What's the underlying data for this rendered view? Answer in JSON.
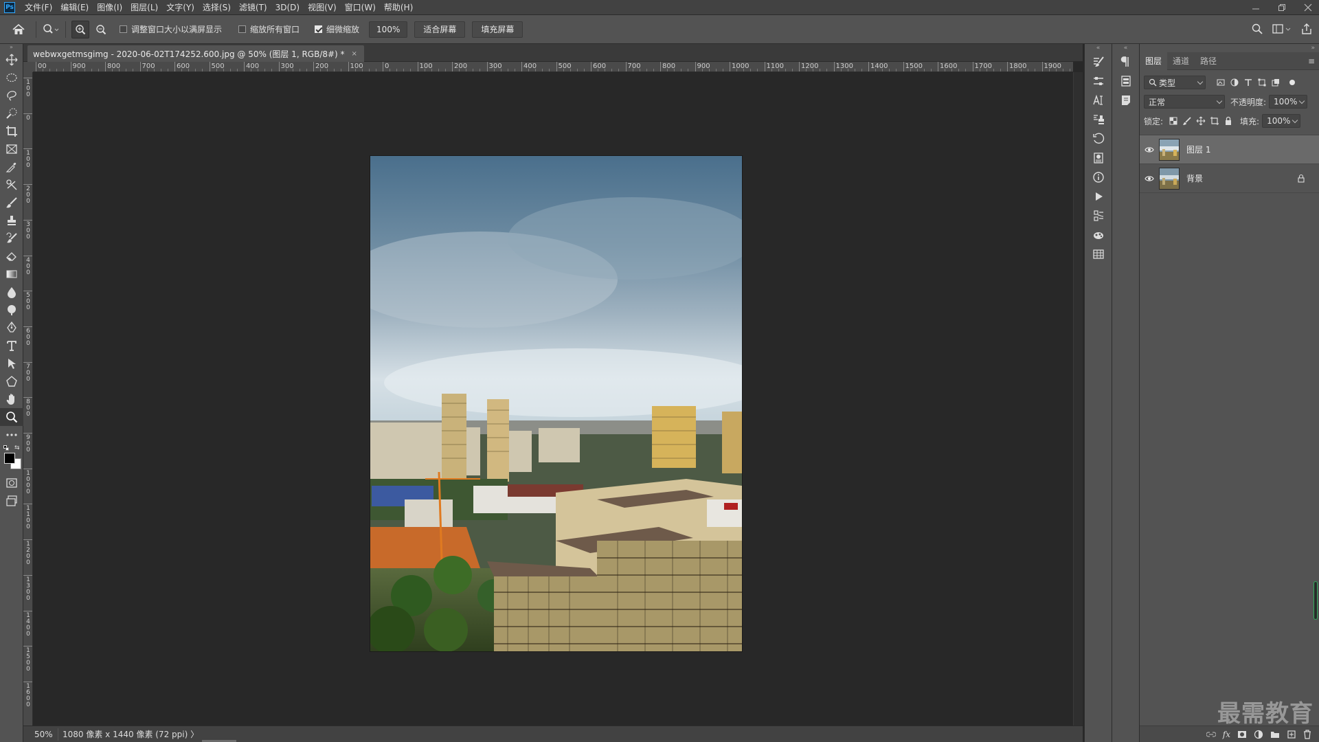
{
  "app": {
    "logo": "Ps"
  },
  "menu": [
    "文件(F)",
    "编辑(E)",
    "图像(I)",
    "图层(L)",
    "文字(Y)",
    "选择(S)",
    "滤镜(T)",
    "3D(D)",
    "视图(V)",
    "窗口(W)",
    "帮助(H)"
  ],
  "options": {
    "resize_windows": "调整窗口大小以满屏显示",
    "zoom_all": "缩放所有窗口",
    "scrubby_zoom": "细微缩放",
    "zoom_value": "100%",
    "fit_screen": "适合屏幕",
    "fill_screen": "填充屏幕"
  },
  "document": {
    "tab_title": "webwxgetmsgimg - 2020-06-02T174252.600.jpg @ 50% (图层 1, RGB/8#) *",
    "close": "×"
  },
  "ruler": {
    "h_labels": [
      "00",
      "900",
      "800",
      "700",
      "600",
      "500",
      "400",
      "300",
      "200",
      "100",
      "0",
      "100",
      "200",
      "300",
      "400",
      "500",
      "600",
      "700",
      "800",
      "900",
      "1000",
      "1100",
      "1200",
      "1300",
      "1400",
      "1500",
      "1600",
      "1700",
      "1800",
      "1900",
      "200"
    ],
    "v_labels": [
      "100",
      "0",
      "100",
      "200",
      "300",
      "400",
      "500",
      "600",
      "700",
      "800",
      "900",
      "1000",
      "1100",
      "1200",
      "1300",
      "1400",
      "1500",
      "1600"
    ]
  },
  "status": {
    "zoom": "50%",
    "doc_info": "1080 像素 x 1440 像素 (72 ppi)",
    "arrow": "〉"
  },
  "layers_panel": {
    "tabs": [
      "图层",
      "通道",
      "路径"
    ],
    "filter_label": "类型",
    "blend_mode": "正常",
    "opacity_label": "不透明度:",
    "opacity_value": "100%",
    "lock_label": "锁定:",
    "fill_label": "填充:",
    "fill_value": "100%",
    "layers": [
      {
        "name": "图层 1",
        "selected": true
      },
      {
        "name": "背景",
        "locked": true
      }
    ]
  },
  "watermark": "最需教育",
  "colors": {
    "accent": "#31a8ff",
    "panel": "#535353",
    "canvas": "#282828"
  }
}
